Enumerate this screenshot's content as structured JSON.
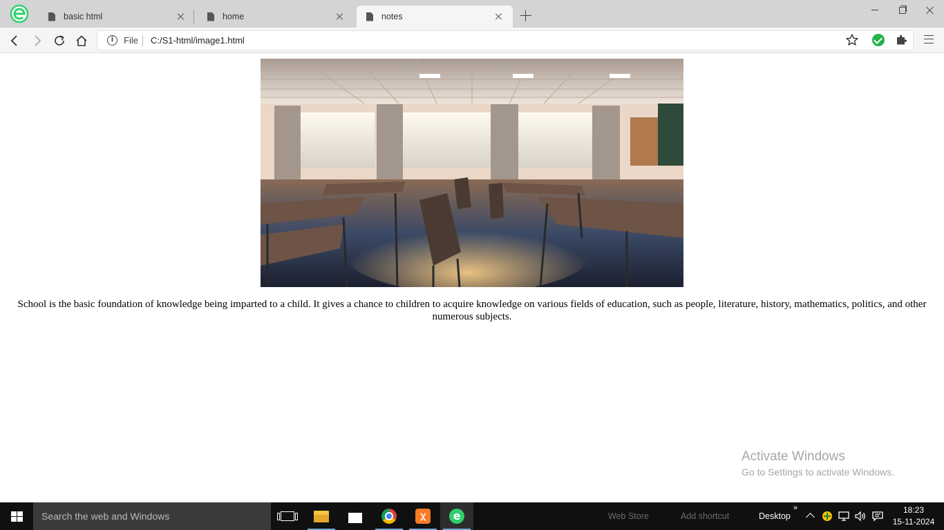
{
  "browser": {
    "tabs": [
      {
        "label": "basic html"
      },
      {
        "label": "home"
      },
      {
        "label": "notes"
      }
    ],
    "address": {
      "scheme": "File",
      "url": "C:/S1-html/image1.html"
    }
  },
  "page": {
    "image_alt": "Empty classroom with desks, chairs and sunlit windows",
    "paragraph": "School is the basic foundation of knowledge being imparted to a child. It gives a chance to children to acquire knowledge on various fields of education, such as people, literature, history, mathematics, politics, and other numerous subjects."
  },
  "watermark": {
    "title": "Activate Windows",
    "subtitle": "Go to Settings to activate Windows."
  },
  "taskbar": {
    "search_placeholder": "Search the web and Windows",
    "toolbar_ghost": [
      "Web Store",
      "Add shortcut"
    ],
    "desktop_label": "Desktop",
    "time": "18:23",
    "date": "15-11-2024",
    "pinned": [
      "task-view",
      "file-explorer",
      "store",
      "chrome",
      "xampp",
      "browser"
    ]
  },
  "colors": {
    "tabstrip": "#d4d4d4",
    "toolbar": "#f5f5f5",
    "taskbar": "#101010",
    "accent_green": "#26b24b"
  }
}
